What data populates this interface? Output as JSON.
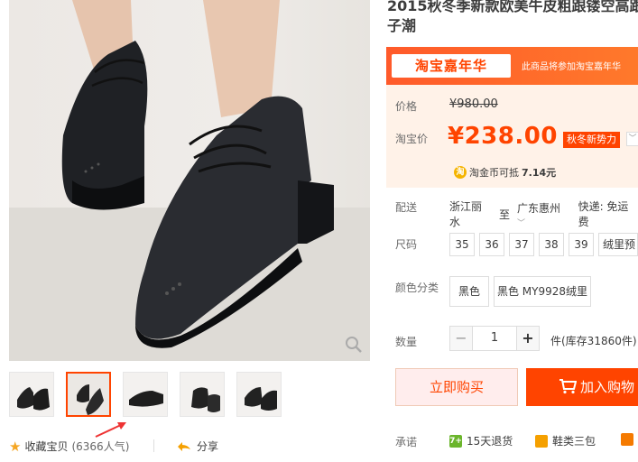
{
  "product": {
    "title": "2015秋冬季新款欧美牛皮粗跟镂空高跟子潮"
  },
  "promo": {
    "logo_text": "淘宝嘉年华",
    "note": "此商品将参加淘宝嘉年华"
  },
  "price": {
    "original_label": "价格",
    "original_value": "¥980.00",
    "tb_label": "淘宝价",
    "currency_symbol": "¥",
    "tb_value": "238.00",
    "badge": "秋冬新势力",
    "badge_arrow": "﹀",
    "coin_icon": "淘",
    "coin_text": "淘金币可抵",
    "coin_value": "7.14元"
  },
  "shipping": {
    "label": "配送",
    "from": "浙江丽水",
    "to_word": "至",
    "to": "广东惠州",
    "express": "快递: 免运费"
  },
  "size": {
    "label": "尺码",
    "options": [
      "35",
      "36",
      "37",
      "38",
      "39",
      "绒里预"
    ]
  },
  "color": {
    "label": "颜色分类",
    "options": [
      "黑色",
      "黑色 MY9928绒里"
    ]
  },
  "quantity": {
    "label": "数量",
    "minus": "−",
    "value": "1",
    "plus": "+",
    "stock": "件(库存31860件)"
  },
  "actions": {
    "buy_now": "立即购买",
    "add_cart": "加入购物"
  },
  "promise": {
    "label": "承诺",
    "items": [
      {
        "icon": "7+",
        "text": "15天退货",
        "color": "#6bb52c"
      },
      {
        "icon": "鞋",
        "text": "鞋类三包",
        "color": "#f5a000"
      },
      {
        "icon": "",
        "text": "",
        "color": "#f57a00"
      }
    ]
  },
  "footer": {
    "fav_label": "收藏宝贝",
    "fav_count": "(6366人气)",
    "share_label": "分享"
  },
  "colors": {
    "accent": "#ff4400",
    "price_bg": "#fff2e8"
  }
}
